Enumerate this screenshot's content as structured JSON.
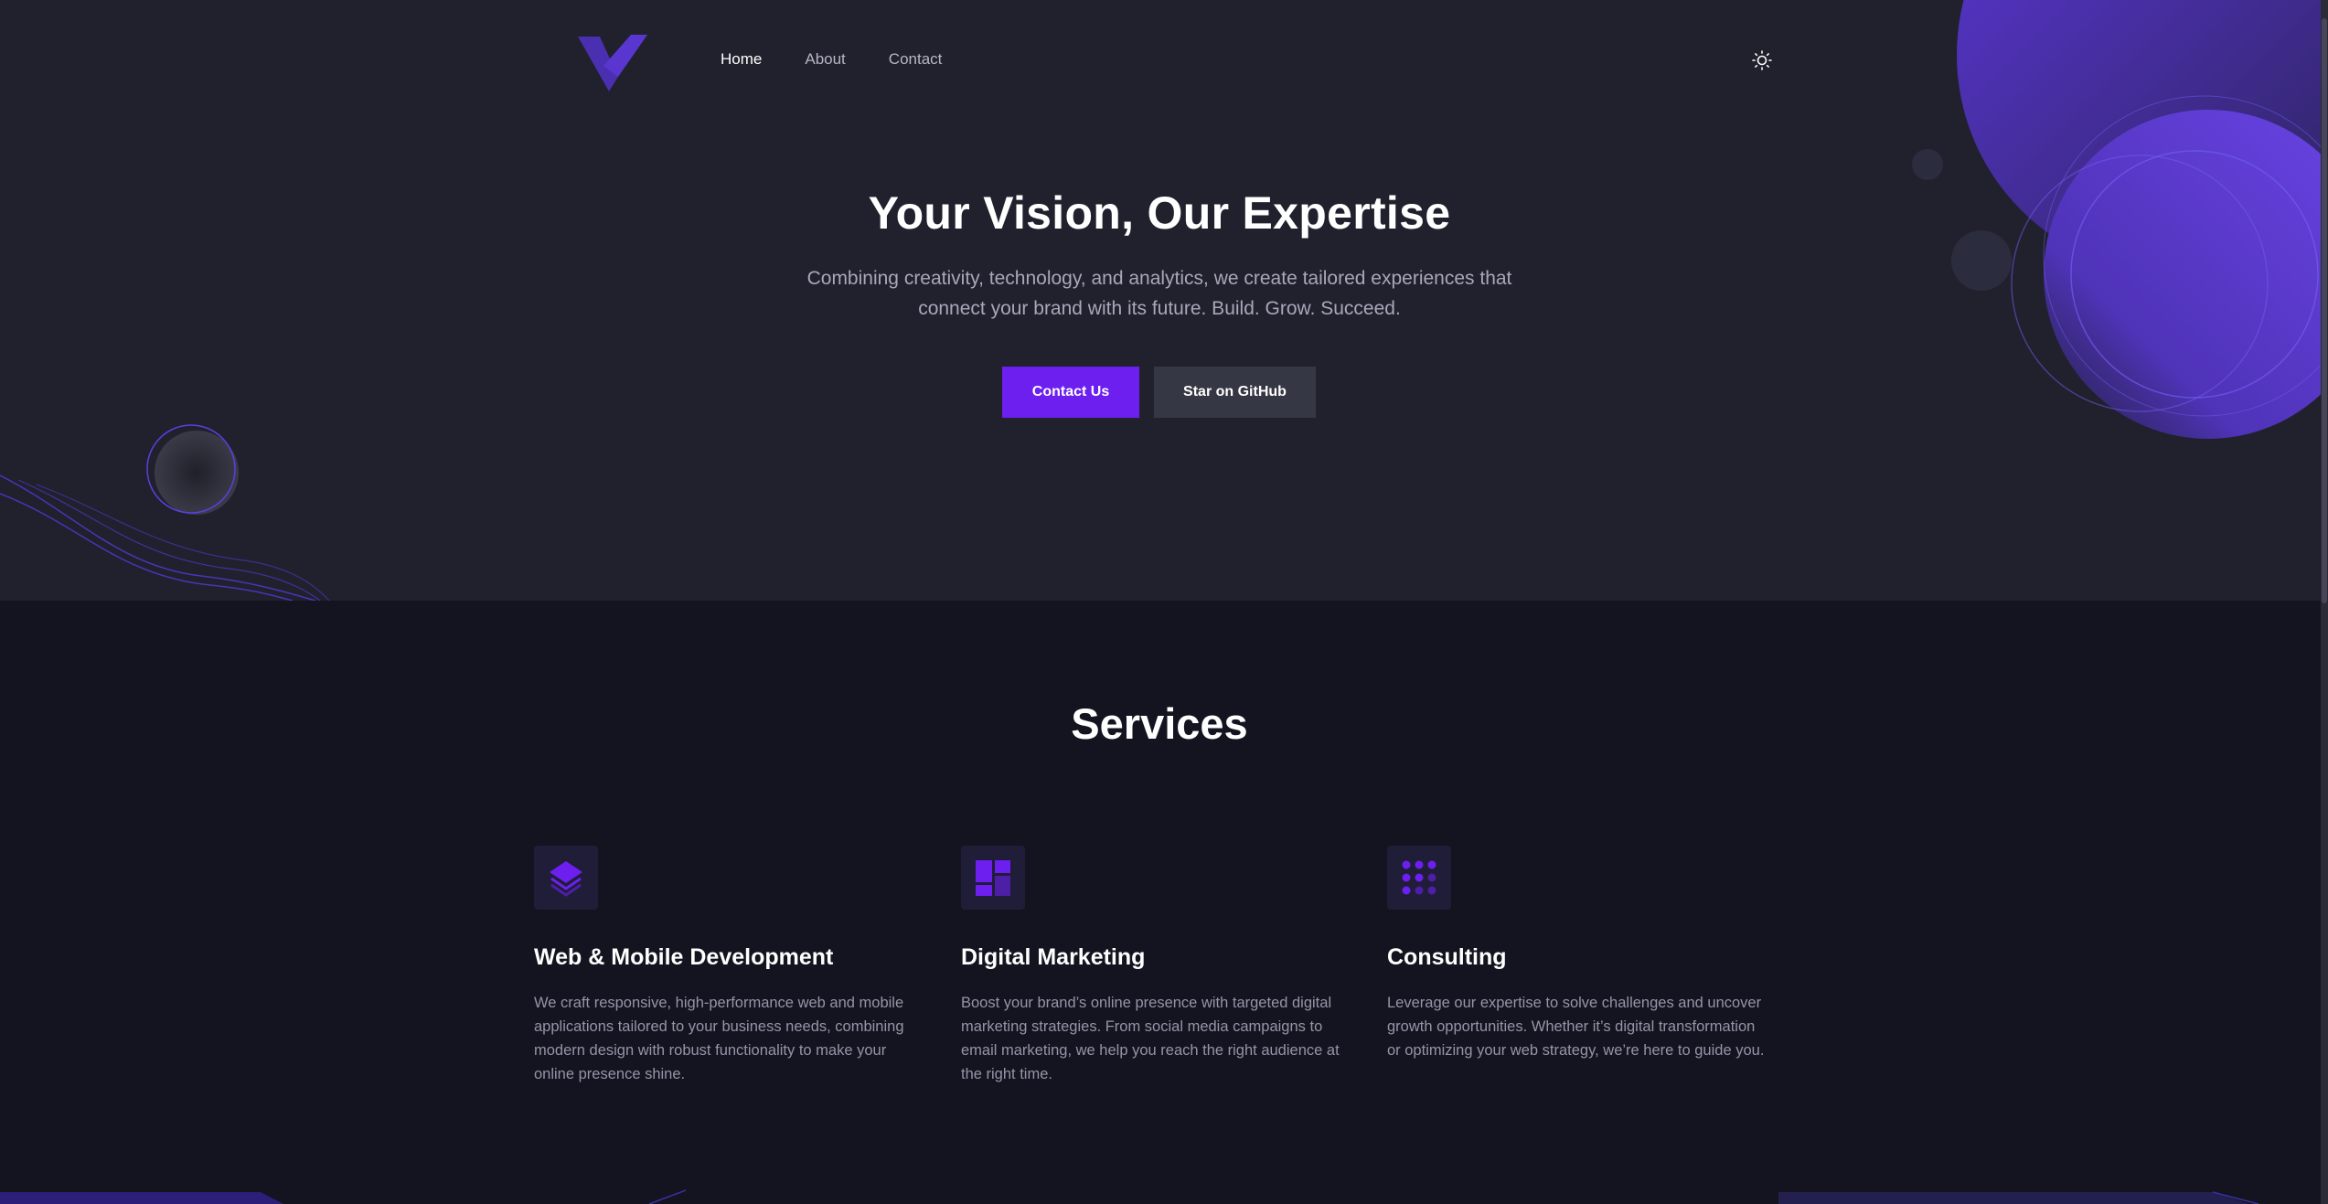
{
  "nav": {
    "links": [
      {
        "label": "Home",
        "active": true
      },
      {
        "label": "About",
        "active": false
      },
      {
        "label": "Contact",
        "active": false
      }
    ],
    "theme_toggle_icon": "sun-icon",
    "logo_icon": "v-logo-icon"
  },
  "hero": {
    "title": "Your Vision, Our Expertise",
    "subtitle": "Combining creativity, technology, and analytics, we create tailored experiences that connect your brand with its future. Build. Grow. Succeed.",
    "primary_button": "Contact Us",
    "secondary_button": "Star on GitHub"
  },
  "services": {
    "title": "Services",
    "items": [
      {
        "icon": "layers-icon",
        "title": "Web & Mobile Development",
        "text": "We craft responsive, high-performance web and mobile applications tailored to your business needs, combining modern design with robust functionality to make your online presence shine."
      },
      {
        "icon": "dashboard-icon",
        "title": "Digital Marketing",
        "text": "Boost your brand’s online presence with targeted digital marketing strategies. From social media campaigns to email marketing, we help you reach the right audience at the right time."
      },
      {
        "icon": "grid-dots-icon",
        "title": "Consulting",
        "text": "Leverage our expertise to solve challenges and uncover growth opportunities. Whether it’s digital transformation or optimizing your web strategy, we’re here to guide you."
      }
    ]
  },
  "colors": {
    "accent": "#6d1ff0",
    "hero_bg": "#20212d",
    "page_bg": "#13141f",
    "secondary_button": "#363744"
  }
}
